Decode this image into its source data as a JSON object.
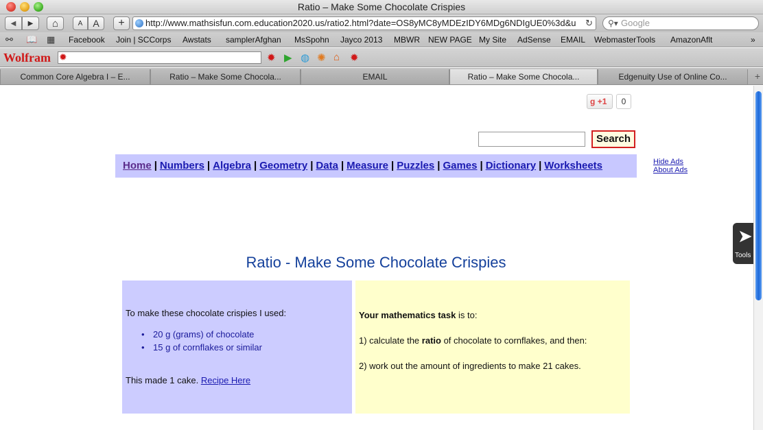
{
  "window": {
    "title": "Ratio – Make Some Chocolate Crispies"
  },
  "toolbar": {
    "back_icon": "◀",
    "forward_icon": "▶",
    "home_icon": "⌂",
    "text_small": "A",
    "text_large": "A",
    "add_icon": "+",
    "url": "http://www.mathsisfun.com.education2020.us/ratio2.html?date=OS8yMC8yMDEzIDY6MDg6NDIgUE0%3d&u",
    "reload_icon": "↻",
    "search_placeholder": "Google"
  },
  "bookmarks": {
    "items": [
      "Facebook",
      "Join | SCCorps",
      "Awstats",
      "samplerAfghan",
      "MsSpohn",
      "Jayco 2013",
      "MBWR",
      "NEW PAGE",
      "My Site",
      "AdSense",
      "EMAIL",
      "WebmasterTools",
      "AmazonAflt"
    ],
    "overflow": "»"
  },
  "wolfram": {
    "logo": "Wolfram"
  },
  "tabs": [
    {
      "label": "Common Core Algebra I – E...",
      "active": false
    },
    {
      "label": "Ratio – Make Some Chocola...",
      "active": false
    },
    {
      "label": "EMAIL",
      "active": false
    },
    {
      "label": "Ratio – Make Some Chocola...",
      "active": true
    },
    {
      "label": "Edgenuity Use of Online Co...",
      "active": false
    }
  ],
  "social": {
    "gplus_label": "+1",
    "gplus_count": "0"
  },
  "site_search": {
    "button_label": "Search"
  },
  "nav": {
    "items": [
      "Home",
      "Numbers",
      "Algebra",
      "Geometry",
      "Data",
      "Measure",
      "Puzzles",
      "Games",
      "Dictionary",
      "Worksheets"
    ],
    "separator": "|"
  },
  "ads": {
    "hide": "Hide Ads",
    "about": "About Ads"
  },
  "content": {
    "title": "Ratio - Make Some Chocolate Crispies",
    "left": {
      "intro": "To make these chocolate crispies I used:",
      "ingredients": [
        "20 g (grams) of chocolate",
        "15 g of cornflakes or similar"
      ],
      "made_text": "This made 1 cake. ",
      "recipe_link": "Recipe Here"
    },
    "right": {
      "task_bold": "Your mathematics task",
      "task_rest": " is to:",
      "step1_pre": "1) calculate the ",
      "step1_bold": "ratio",
      "step1_post": " of chocolate to cornflakes, and then:",
      "step2": "2) work out the amount of ingredients to make 21 cakes."
    }
  },
  "tools": {
    "label": "Tools"
  }
}
